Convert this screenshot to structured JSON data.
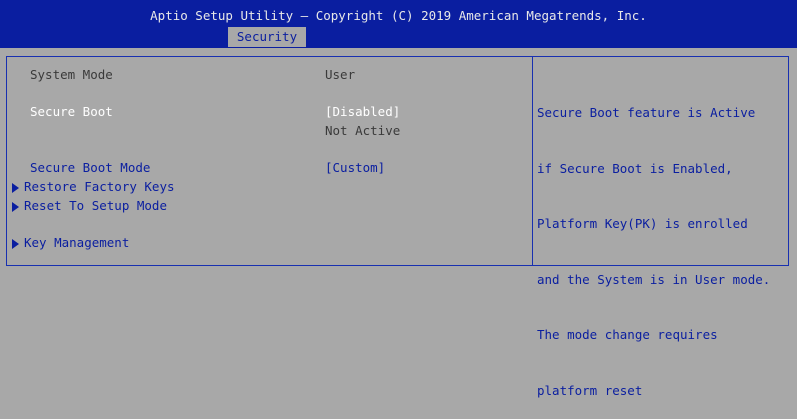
{
  "header": {
    "title": "Aptio Setup Utility – Copyright (C) 2019 American Megatrends, Inc.",
    "active_tab": "Security"
  },
  "settings": {
    "system_mode": {
      "label": "System Mode",
      "value": "User"
    },
    "secure_boot": {
      "label": "Secure Boot",
      "value": "[Disabled]",
      "status": "Not Active"
    },
    "secure_boot_mode": {
      "label": "Secure Boot Mode",
      "value": "[Custom]"
    },
    "restore_factory_keys": {
      "label": "Restore Factory Keys"
    },
    "reset_to_setup_mode": {
      "label": "Reset To Setup Mode"
    },
    "key_management": {
      "label": "Key Management"
    }
  },
  "help": {
    "lines": [
      "Secure Boot feature is Active",
      "if Secure Boot is Enabled,",
      "Platform Key(PK) is enrolled",
      "and the System is in User mode.",
      "The mode change requires",
      "platform reset"
    ]
  },
  "colors": {
    "header_bg": "#0a1ea0",
    "panel_bg": "#a8a8a8",
    "selectable_text": "#0a1ea0",
    "highlight_text": "#ffffff",
    "static_text": "#3a3a3a"
  }
}
